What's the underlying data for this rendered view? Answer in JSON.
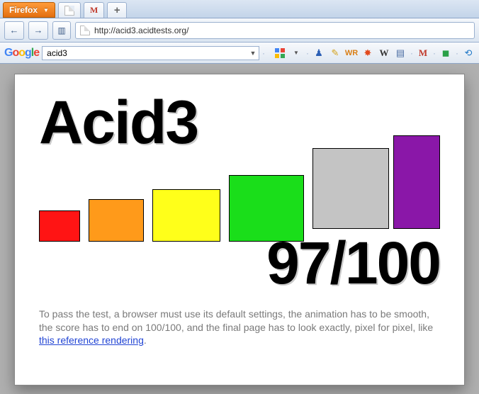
{
  "chrome": {
    "firefox_button": "Firefox",
    "tab_gmail": "M",
    "tab_new": "+",
    "url": "http://acid3.acidtests.org/"
  },
  "gbar": {
    "search_value": "acid3",
    "icon_labels": [
      "g",
      "·",
      "pawn",
      "autofill",
      "wr",
      "sun",
      "W",
      "drop",
      "M",
      "drop2",
      "sq",
      "drop3",
      "trans"
    ]
  },
  "acid": {
    "title": "Acid3",
    "score": "97/100",
    "desc_1": "To pass the test, a browser must use its default settings, the animation has to be smooth, the score has to end on 100/100, and the final page has to look exactly, pixel for pixel, like ",
    "link_text": "this reference rendering",
    "desc_2": "."
  }
}
